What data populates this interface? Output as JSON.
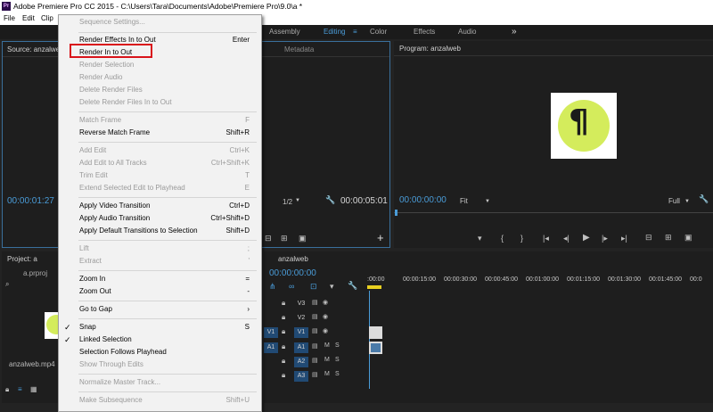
{
  "app": {
    "title": "Adobe Premiere Pro CC 2015 - C:\\Users\\Tara\\Documents\\Adobe\\Premiere Pro\\9.0\\a *",
    "logo_text": "Pr"
  },
  "menubar": {
    "items": [
      "File",
      "Edit",
      "Clip"
    ]
  },
  "workspace_tabs": {
    "assembly": "Assembly",
    "editing": "Editing",
    "color": "Color",
    "effects": "Effects",
    "audio": "Audio",
    "more": "»",
    "menu_icon": "≡"
  },
  "source_panel": {
    "tab": "Source: anzalweb",
    "metadata_tab": "Metadata",
    "timecode_left": "00:00:01:27",
    "resolution": "1/2",
    "timecode_right": "00:00:05:01",
    "add_button": "+"
  },
  "program_panel": {
    "tab": "Program: anzalweb",
    "timecode_left": "00:00:00:00",
    "fit": "Fit",
    "full": "Full"
  },
  "project_panel": {
    "tab": "Project: a",
    "file": "a.prproj",
    "clip_name": "anzalweb.mp4"
  },
  "timeline": {
    "tab": "anzalweb",
    "timecode": "00:00:00:00",
    "ruler": [
      ":00:00",
      "00:00:15:00",
      "00:00:30:00",
      "00:00:45:00",
      "00:01:00:00",
      "00:01:15:00",
      "00:01:30:00",
      "00:01:45:00",
      "00:0"
    ],
    "video_tracks": [
      "V3",
      "V2",
      "V1"
    ],
    "audio_tracks": [
      "A1",
      "A2",
      "A3"
    ],
    "source_v": "V1",
    "source_a": "A1",
    "m_label": "M",
    "s_label": "S"
  },
  "context_menu": {
    "items": [
      {
        "label": "Sequence Settings...",
        "shortcut": "",
        "disabled": true
      },
      {
        "label": "Render Effects In to Out",
        "shortcut": "Enter",
        "disabled": false
      },
      {
        "label": "Render In to Out",
        "shortcut": "",
        "disabled": false
      },
      {
        "label": "Render Selection",
        "shortcut": "",
        "disabled": true
      },
      {
        "label": "Render Audio",
        "shortcut": "",
        "disabled": true
      },
      {
        "label": "Delete Render Files",
        "shortcut": "",
        "disabled": true
      },
      {
        "label": "Delete Render Files In to Out",
        "shortcut": "",
        "disabled": true
      },
      {
        "label": "Match Frame",
        "shortcut": "F",
        "disabled": true
      },
      {
        "label": "Reverse Match Frame",
        "shortcut": "Shift+R",
        "disabled": false
      },
      {
        "label": "Add Edit",
        "shortcut": "Ctrl+K",
        "disabled": true
      },
      {
        "label": "Add Edit to All Tracks",
        "shortcut": "Ctrl+Shift+K",
        "disabled": true
      },
      {
        "label": "Trim Edit",
        "shortcut": "T",
        "disabled": true
      },
      {
        "label": "Extend Selected Edit to Playhead",
        "shortcut": "E",
        "disabled": true
      },
      {
        "label": "Apply Video Transition",
        "shortcut": "Ctrl+D",
        "disabled": false
      },
      {
        "label": "Apply Audio Transition",
        "shortcut": "Ctrl+Shift+D",
        "disabled": false
      },
      {
        "label": "Apply Default Transitions to Selection",
        "shortcut": "Shift+D",
        "disabled": false
      },
      {
        "label": "Lift",
        "shortcut": ";",
        "disabled": true
      },
      {
        "label": "Extract",
        "shortcut": "'",
        "disabled": true
      },
      {
        "label": "Zoom In",
        "shortcut": "=",
        "disabled": false
      },
      {
        "label": "Zoom Out",
        "shortcut": "-",
        "disabled": false
      },
      {
        "label": "Go to Gap",
        "shortcut": "",
        "submenu": true,
        "disabled": false
      },
      {
        "label": "Snap",
        "shortcut": "S",
        "checked": true,
        "disabled": false
      },
      {
        "label": "Linked Selection",
        "shortcut": "",
        "checked": true,
        "disabled": false
      },
      {
        "label": "Selection Follows Playhead",
        "shortcut": "",
        "disabled": false
      },
      {
        "label": "Show Through Edits",
        "shortcut": "",
        "disabled": true
      },
      {
        "label": "Normalize Master Track...",
        "shortcut": "",
        "disabled": true
      },
      {
        "label": "Make Subsequence",
        "shortcut": "Shift+U",
        "disabled": true
      }
    ],
    "submenu_arrow": "›",
    "check_mark": "✓"
  },
  "colors": {
    "accent": "#4a9cd8",
    "highlight_box": "#d9141b",
    "logo_green": "#d4ec5c"
  },
  "icons": [
    "wrench-icon",
    "camera-icon",
    "play-icon",
    "step-back-icon",
    "step-forward-icon",
    "marker-icon",
    "lift-icon",
    "extract-icon",
    "lock-icon",
    "eye-icon",
    "snap-icon",
    "linked-icon"
  ]
}
